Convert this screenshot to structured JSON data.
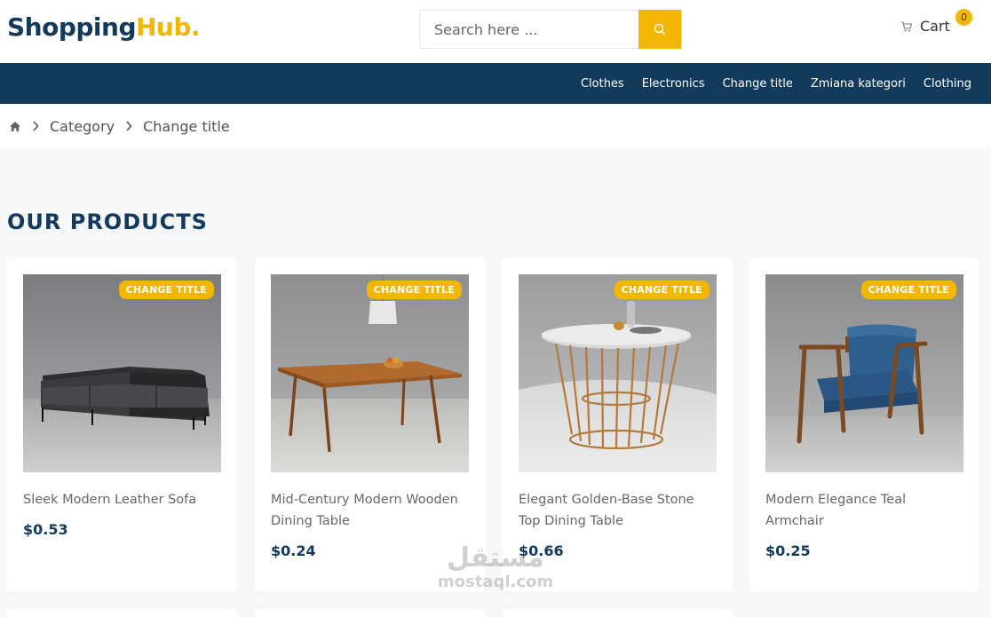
{
  "brand": {
    "name_main": "Shopping",
    "name_accent": "Hub."
  },
  "search": {
    "placeholder": "Search here ..."
  },
  "cart": {
    "label": "Cart",
    "count": "0"
  },
  "nav": {
    "items": [
      "Clothes",
      "Electronics",
      "Change title",
      "Zmiana kategori",
      "Clothing"
    ]
  },
  "breadcrumb": {
    "category": "Category",
    "current": "Change title"
  },
  "section": {
    "title": "OUR PRODUCTS"
  },
  "products": [
    {
      "name": "Sleek Modern Leather Sofa",
      "price": "$0.53",
      "badge": "CHANGE TITLE"
    },
    {
      "name": "Mid-Century Modern Wooden Dining Table",
      "price": "$0.24",
      "badge": "CHANGE TITLE"
    },
    {
      "name": "Elegant Golden-Base Stone Top Dining Table",
      "price": "$0.66",
      "badge": "CHANGE TITLE"
    },
    {
      "name": "Modern Elegance Teal Armchair",
      "price": "$0.25",
      "badge": "CHANGE TITLE"
    }
  ],
  "watermark": {
    "arabic": "مستقل",
    "latin": "mostaql.com"
  },
  "colors": {
    "navy": "#123a5c",
    "accent": "#f2b705"
  }
}
